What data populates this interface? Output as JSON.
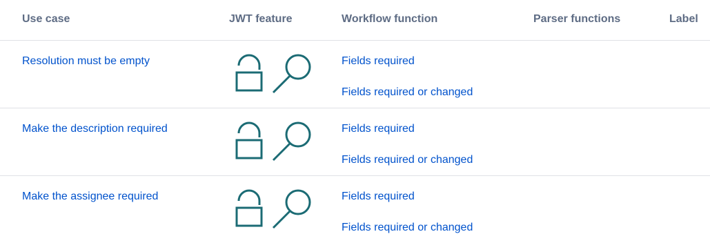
{
  "headers": {
    "use_case": "Use case",
    "jwt_feature": "JWT feature",
    "workflow_function": "Workflow function",
    "parser_functions": "Parser functions",
    "label": "Label"
  },
  "rows": [
    {
      "use_case": "Resolution must be empty",
      "jwt_feature_icons": [
        "unlock-icon",
        "search-icon"
      ],
      "workflow_functions": [
        "Fields required",
        "Fields required or changed"
      ]
    },
    {
      "use_case": "Make the description required",
      "jwt_feature_icons": [
        "unlock-icon",
        "search-icon"
      ],
      "workflow_functions": [
        "Fields required",
        "Fields required or changed"
      ]
    },
    {
      "use_case": "Make the assignee required",
      "jwt_feature_icons": [
        "unlock-icon",
        "search-icon"
      ],
      "workflow_functions": [
        "Fields required",
        "Fields required or changed"
      ]
    }
  ],
  "colors": {
    "link": "#0052cc",
    "header_text": "#5e6c84",
    "icon": "#1b6b74",
    "divider": "#dfe1e6"
  }
}
